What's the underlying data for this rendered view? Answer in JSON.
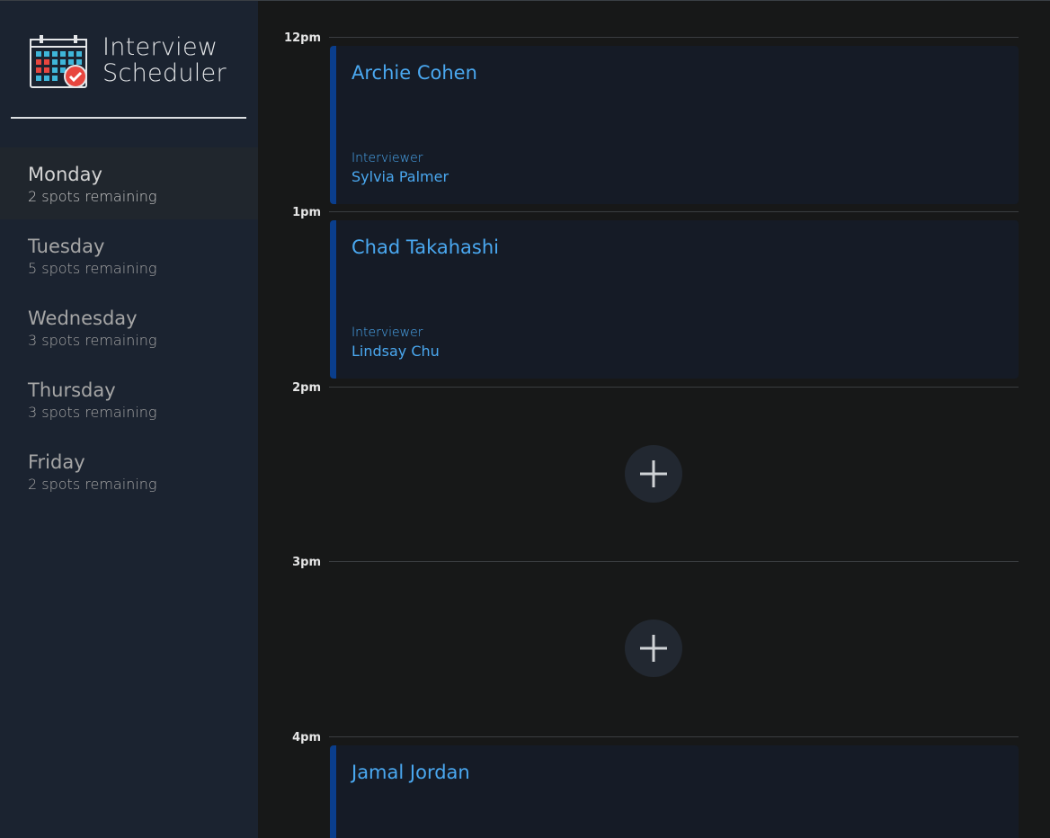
{
  "brand": {
    "line1": "Interview",
    "line2": "Scheduler"
  },
  "icons": {
    "logo": "calendar-check-icon",
    "add": "plus-icon"
  },
  "days": [
    {
      "name": "Monday",
      "spots": "2 spots remaining",
      "selected": true
    },
    {
      "name": "Tuesday",
      "spots": "5 spots remaining",
      "selected": false
    },
    {
      "name": "Wednesday",
      "spots": "3 spots remaining",
      "selected": false
    },
    {
      "name": "Thursday",
      "spots": "3 spots remaining",
      "selected": false
    },
    {
      "name": "Friday",
      "spots": "2 spots remaining",
      "selected": false
    }
  ],
  "appointments": [
    {
      "time": "12pm",
      "student": "Archie Cohen",
      "interviewer_label": "Interviewer",
      "interviewer": "Sylvia Palmer"
    },
    {
      "time": "1pm",
      "student": "Chad Takahashi",
      "interviewer_label": "Interviewer",
      "interviewer": "Lindsay Chu"
    },
    {
      "time": "2pm",
      "student": null
    },
    {
      "time": "3pm",
      "student": null
    },
    {
      "time": "4pm",
      "student": "Jamal Jordan",
      "interviewer_label": "",
      "interviewer": ""
    }
  ],
  "colors": {
    "accent": "#4aa8f0",
    "card_border": "#0a3e8c",
    "sidebar": "#1b2330",
    "background": "#171818"
  }
}
